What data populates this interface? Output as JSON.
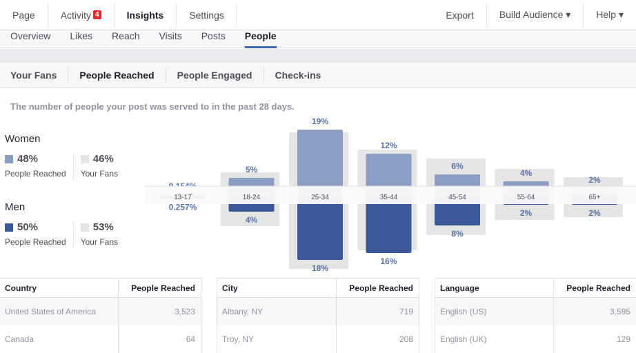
{
  "nav": {
    "items": [
      {
        "label": "Page"
      },
      {
        "label": "Activity",
        "badge": "4"
      },
      {
        "label": "Insights"
      },
      {
        "label": "Settings"
      }
    ],
    "right": [
      {
        "label": "Export"
      },
      {
        "label": "Build Audience ▾"
      },
      {
        "label": "Help ▾"
      }
    ]
  },
  "subnav": [
    "Overview",
    "Likes",
    "Reach",
    "Visits",
    "Posts",
    "People"
  ],
  "tabs": [
    "Your Fans",
    "People Reached",
    "People Engaged",
    "Check-ins"
  ],
  "description": "The number of people your post was served to in the past 28 days.",
  "legend": {
    "women": {
      "title": "Women",
      "reached": "48%",
      "fans": "46%"
    },
    "men": {
      "title": "Men",
      "reached": "50%",
      "fans": "53%"
    },
    "reached_label": "People Reached",
    "fans_label": "Your Fans"
  },
  "colors": {
    "women": "#8b9dc3",
    "men": "#3b5998",
    "fans": "#e5e5e5"
  },
  "chart_data": {
    "type": "bar",
    "categories": [
      "13-17",
      "18-24",
      "25-34",
      "35-44",
      "45-54",
      "55-64",
      "65+"
    ],
    "series": [
      {
        "name": "Women People Reached",
        "values": [
          0.154,
          5,
          19,
          12,
          6,
          4,
          2
        ],
        "labels": [
          "0.154%",
          "5%",
          "19%",
          "12%",
          "6%",
          "4%",
          "2%"
        ]
      },
      {
        "name": "Men People Reached",
        "values": [
          0.257,
          4,
          18,
          16,
          8,
          2,
          2
        ],
        "labels": [
          "0.257%",
          "4%",
          "18%",
          "16%",
          "8%",
          "2%",
          "2%"
        ]
      },
      {
        "name": "Women Your Fans",
        "values": [
          0.3,
          5.4,
          17,
          12,
          9.4,
          6.4,
          4
        ]
      },
      {
        "name": "Men Your Fans",
        "values": [
          0.5,
          7,
          19.4,
          14,
          9.6,
          5.2,
          4.4
        ]
      }
    ]
  },
  "tables": [
    {
      "headers": [
        "Country",
        "People Reached"
      ],
      "rows": [
        [
          "United States of America",
          "3,523"
        ],
        [
          "Canada",
          "64"
        ]
      ]
    },
    {
      "headers": [
        "City",
        "People Reached"
      ],
      "rows": [
        [
          "Albany, NY",
          "719"
        ],
        [
          "Troy, NY",
          "208"
        ]
      ]
    },
    {
      "headers": [
        "Language",
        "People Reached"
      ],
      "rows": [
        [
          "English (US)",
          "3,595"
        ],
        [
          "English (UK)",
          "129"
        ]
      ]
    }
  ]
}
